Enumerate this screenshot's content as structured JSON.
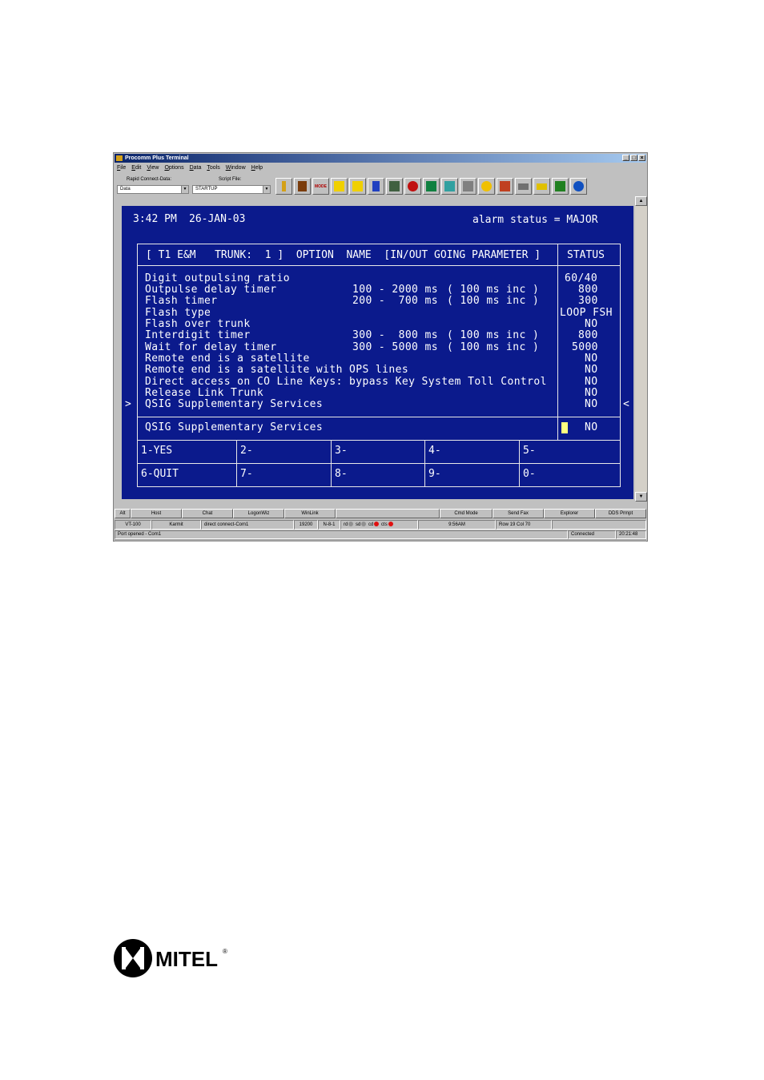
{
  "window": {
    "title": "Procomm Plus Terminal",
    "controls": {
      "minimize": "_",
      "maximize": "□",
      "close": "×"
    },
    "menu": [
      "File",
      "Edit",
      "View",
      "Options",
      "Data",
      "Tools",
      "Window",
      "Help"
    ]
  },
  "toolbar": {
    "rapid_connect_label": "Rapid Connect-Data:",
    "rapid_connect_value": "Data",
    "script_file_label": "Script File:",
    "script_file_value": "STARTUP",
    "mode_label": "MODE"
  },
  "terminal": {
    "time": "3:42 PM",
    "date": "26-JAN-03",
    "alarm": "alarm status = MAJOR",
    "header": "[ T1 E&M   TRUNK:  1 ]  OPTION  NAME  [IN/OUT GOING PARAMETER ]",
    "status_header": "STATUS",
    "options": [
      {
        "name": "Digit outpulsing ratio",
        "range": "",
        "inc": "",
        "status": "60/40"
      },
      {
        "name": "Outpulse delay timer",
        "range": "100 - 2000 ms",
        "inc": "( 100 ms inc )",
        "status": "800"
      },
      {
        "name": "Flash timer",
        "range": "200 -  700 ms",
        "inc": "( 100 ms inc )",
        "status": "300"
      },
      {
        "name": "Flash type",
        "range": "",
        "inc": "",
        "status": "LOOP FSH"
      },
      {
        "name": "Flash over trunk",
        "range": "",
        "inc": "",
        "status": "NO"
      },
      {
        "name": "Interdigit timer",
        "range": "300 -  800 ms",
        "inc": "( 100 ms inc )",
        "status": "800"
      },
      {
        "name": "Wait for delay timer",
        "range": "300 - 5000 ms",
        "inc": "( 100 ms inc )",
        "status": "5000"
      },
      {
        "name": "Remote end is a satellite",
        "range": "",
        "inc": "",
        "status": "NO"
      },
      {
        "name": "Remote end is a satellite with OPS lines",
        "range": "",
        "inc": "",
        "status": "NO"
      },
      {
        "name": "Direct access on CO Line Keys: bypass Key System Toll Control",
        "range": "",
        "inc": "",
        "status": "NO"
      },
      {
        "name": "Release Link Trunk",
        "range": "",
        "inc": "",
        "status": "NO"
      },
      {
        "name": "QSIG Supplementary Services",
        "range": "",
        "inc": "",
        "status": "NO"
      }
    ],
    "left_marker": ">",
    "right_marker": "<",
    "selected_name": "QSIG Supplementary Services",
    "selected_status": "NO",
    "softkeys": [
      "1-YES",
      "2-",
      "3-",
      "4-",
      "5-",
      "6-QUIT",
      "7-",
      "8-",
      "9-",
      "0-"
    ]
  },
  "button_bar": [
    "Alt",
    "Host",
    "Chat",
    "LogonWiz",
    "WinLink",
    "",
    "Cmd Mode",
    "Send Fax",
    "Explorer",
    "DDS Prmpt"
  ],
  "status_bar": {
    "emulation": "VT-100",
    "user": "Karmit",
    "connection": "direct connect-Com1",
    "baud": "19200",
    "format": "N-8-1",
    "leds": [
      "rd",
      "sd",
      "cd",
      "cts"
    ],
    "clock": "9:56AM",
    "position": "Row 19   Col 70"
  },
  "message_bar": {
    "message": "Port opened - Com1",
    "state": "Connected",
    "elapsed": "20:21:48"
  },
  "logo": {
    "text": "MITEL",
    "mark": "®"
  },
  "colors": {
    "terminal_bg": "#0b1a8c",
    "text": "#ffffff",
    "cursor": "#ffff80",
    "led_red": "#e01010",
    "led_grey": "#909090"
  }
}
